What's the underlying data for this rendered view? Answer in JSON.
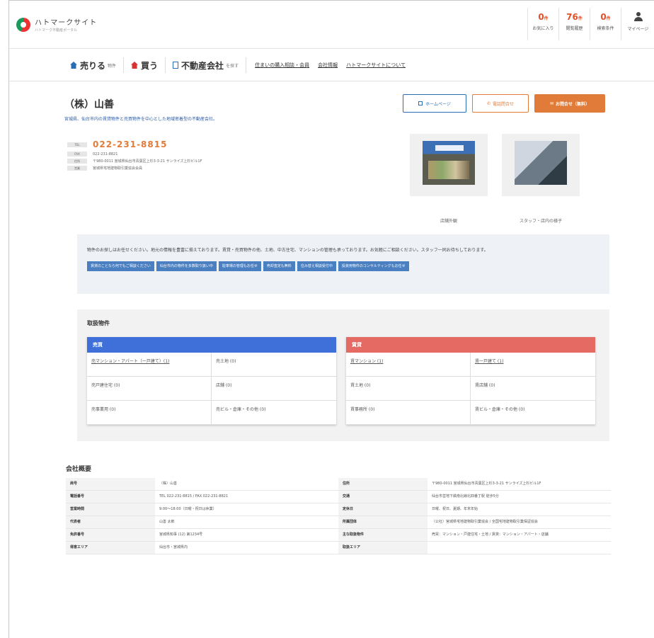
{
  "header": {
    "logo_name": "ハトマークサイト",
    "logo_sub": "ハトマーク不動産ポータル",
    "stats": [
      {
        "num": "0",
        "unit": "件",
        "label": "お気に入り"
      },
      {
        "num": "76",
        "unit": "件",
        "label": "閲覧履歴"
      },
      {
        "num": "0",
        "unit": "件",
        "label": "検索条件"
      }
    ],
    "member_label": "マイページ"
  },
  "nav": {
    "sell_label": "売りる",
    "sell_sub": "物件",
    "buy_label": "買う",
    "company_label": "不動産会社",
    "company_sub": "を探す",
    "links": [
      "住まいの購入相談・会員",
      "会社情報",
      "ハトマークサイトについて"
    ]
  },
  "company": {
    "name": "（株）山善",
    "tagline": "宮城県、仙台市内の賃貸物件と売買物件を中心とした地域密着型の不動産会社。",
    "buttons": {
      "hp": "ホームページ",
      "tel": "電話問合せ",
      "mail": "お問合せ（無料）"
    },
    "contact": [
      {
        "type": "TEL",
        "value": "022-231-8815",
        "style": "tel"
      },
      {
        "type": "FAX",
        "value": "022-231-8821",
        "style": "plain"
      },
      {
        "type": "住所",
        "value": "〒980-0011 宮城県仙台市青葉区上杉3-3-21 サンライズ上杉ビル1F",
        "style": "plain"
      },
      {
        "type": "営業",
        "value": "宮城県宅地建物取引業協会会員",
        "style": "plain"
      }
    ],
    "photos": [
      {
        "caption": "店舗外観"
      },
      {
        "caption": "スタッフ・店内の様子"
      }
    ]
  },
  "intro": {
    "text": "物件のお探しはお任せください。地元の情報を豊富に揃えております。賃貸・売買物件の他、土地、中古住宅、マンションの管理も承っております。お気軽にご相談ください。スタッフ一同お待ちしております。",
    "tags": [
      "賃貸のことなら何でもご相談ください",
      "仙台市内の物件を多数取り扱い中",
      "駐車場の管理もお任せ",
      "売却査定も無料",
      "住み替え相談受付中",
      "投資用物件のコンサルティングもお任せ"
    ]
  },
  "listings": {
    "title": "取扱物件",
    "sell": {
      "header": "売買",
      "cells": [
        "売マンション・アパート（一戸建て）(1)",
        "売土地 (0)",
        "売戸建住宅 (0)",
        "店舗 (0)",
        "売事業用 (0)",
        "売ビル・倉庫・その他 (0)"
      ]
    },
    "rent": {
      "header": "賃貸",
      "cells": [
        "賃マンション (1)",
        "賃一戸建て (1)",
        "賃土地 (0)",
        "賃店舗 (0)",
        "賃事務所 (0)",
        "賃ビル・倉庫・その他 (0)"
      ]
    }
  },
  "overview": {
    "title": "会社概要",
    "rows": [
      [
        "商号",
        "（株）山善",
        "住所",
        "〒980-0011 宮城県仙台市青葉区上杉3-3-21 サンライズ上杉ビル1F"
      ],
      [
        "電話番号",
        "TEL 022-231-8815 / FAX 022-231-8821",
        "交通",
        "仙台市営地下鉄南北線北四番丁駅 徒歩5分"
      ],
      [
        "営業時間",
        "9:00〜18:00（日曜・祝日は休業）",
        "定休日",
        "日曜、祝日、夏期、年末年始"
      ],
      [
        "代表者",
        "山善 太郎",
        "所属団体",
        "（公社）宮城県宅地建物取引業協会 / 全国宅地建物取引業保証協会"
      ],
      [
        "免許番号",
        "宮城県知事 (12) 第1234号",
        "主な取扱物件",
        "売買：マンション・戸建住宅・土地 / 賃貸：マンション・アパート・店舗"
      ],
      [
        "得意エリア",
        "仙台市・宮城県内",
        "取扱エリア",
        ""
      ]
    ]
  }
}
